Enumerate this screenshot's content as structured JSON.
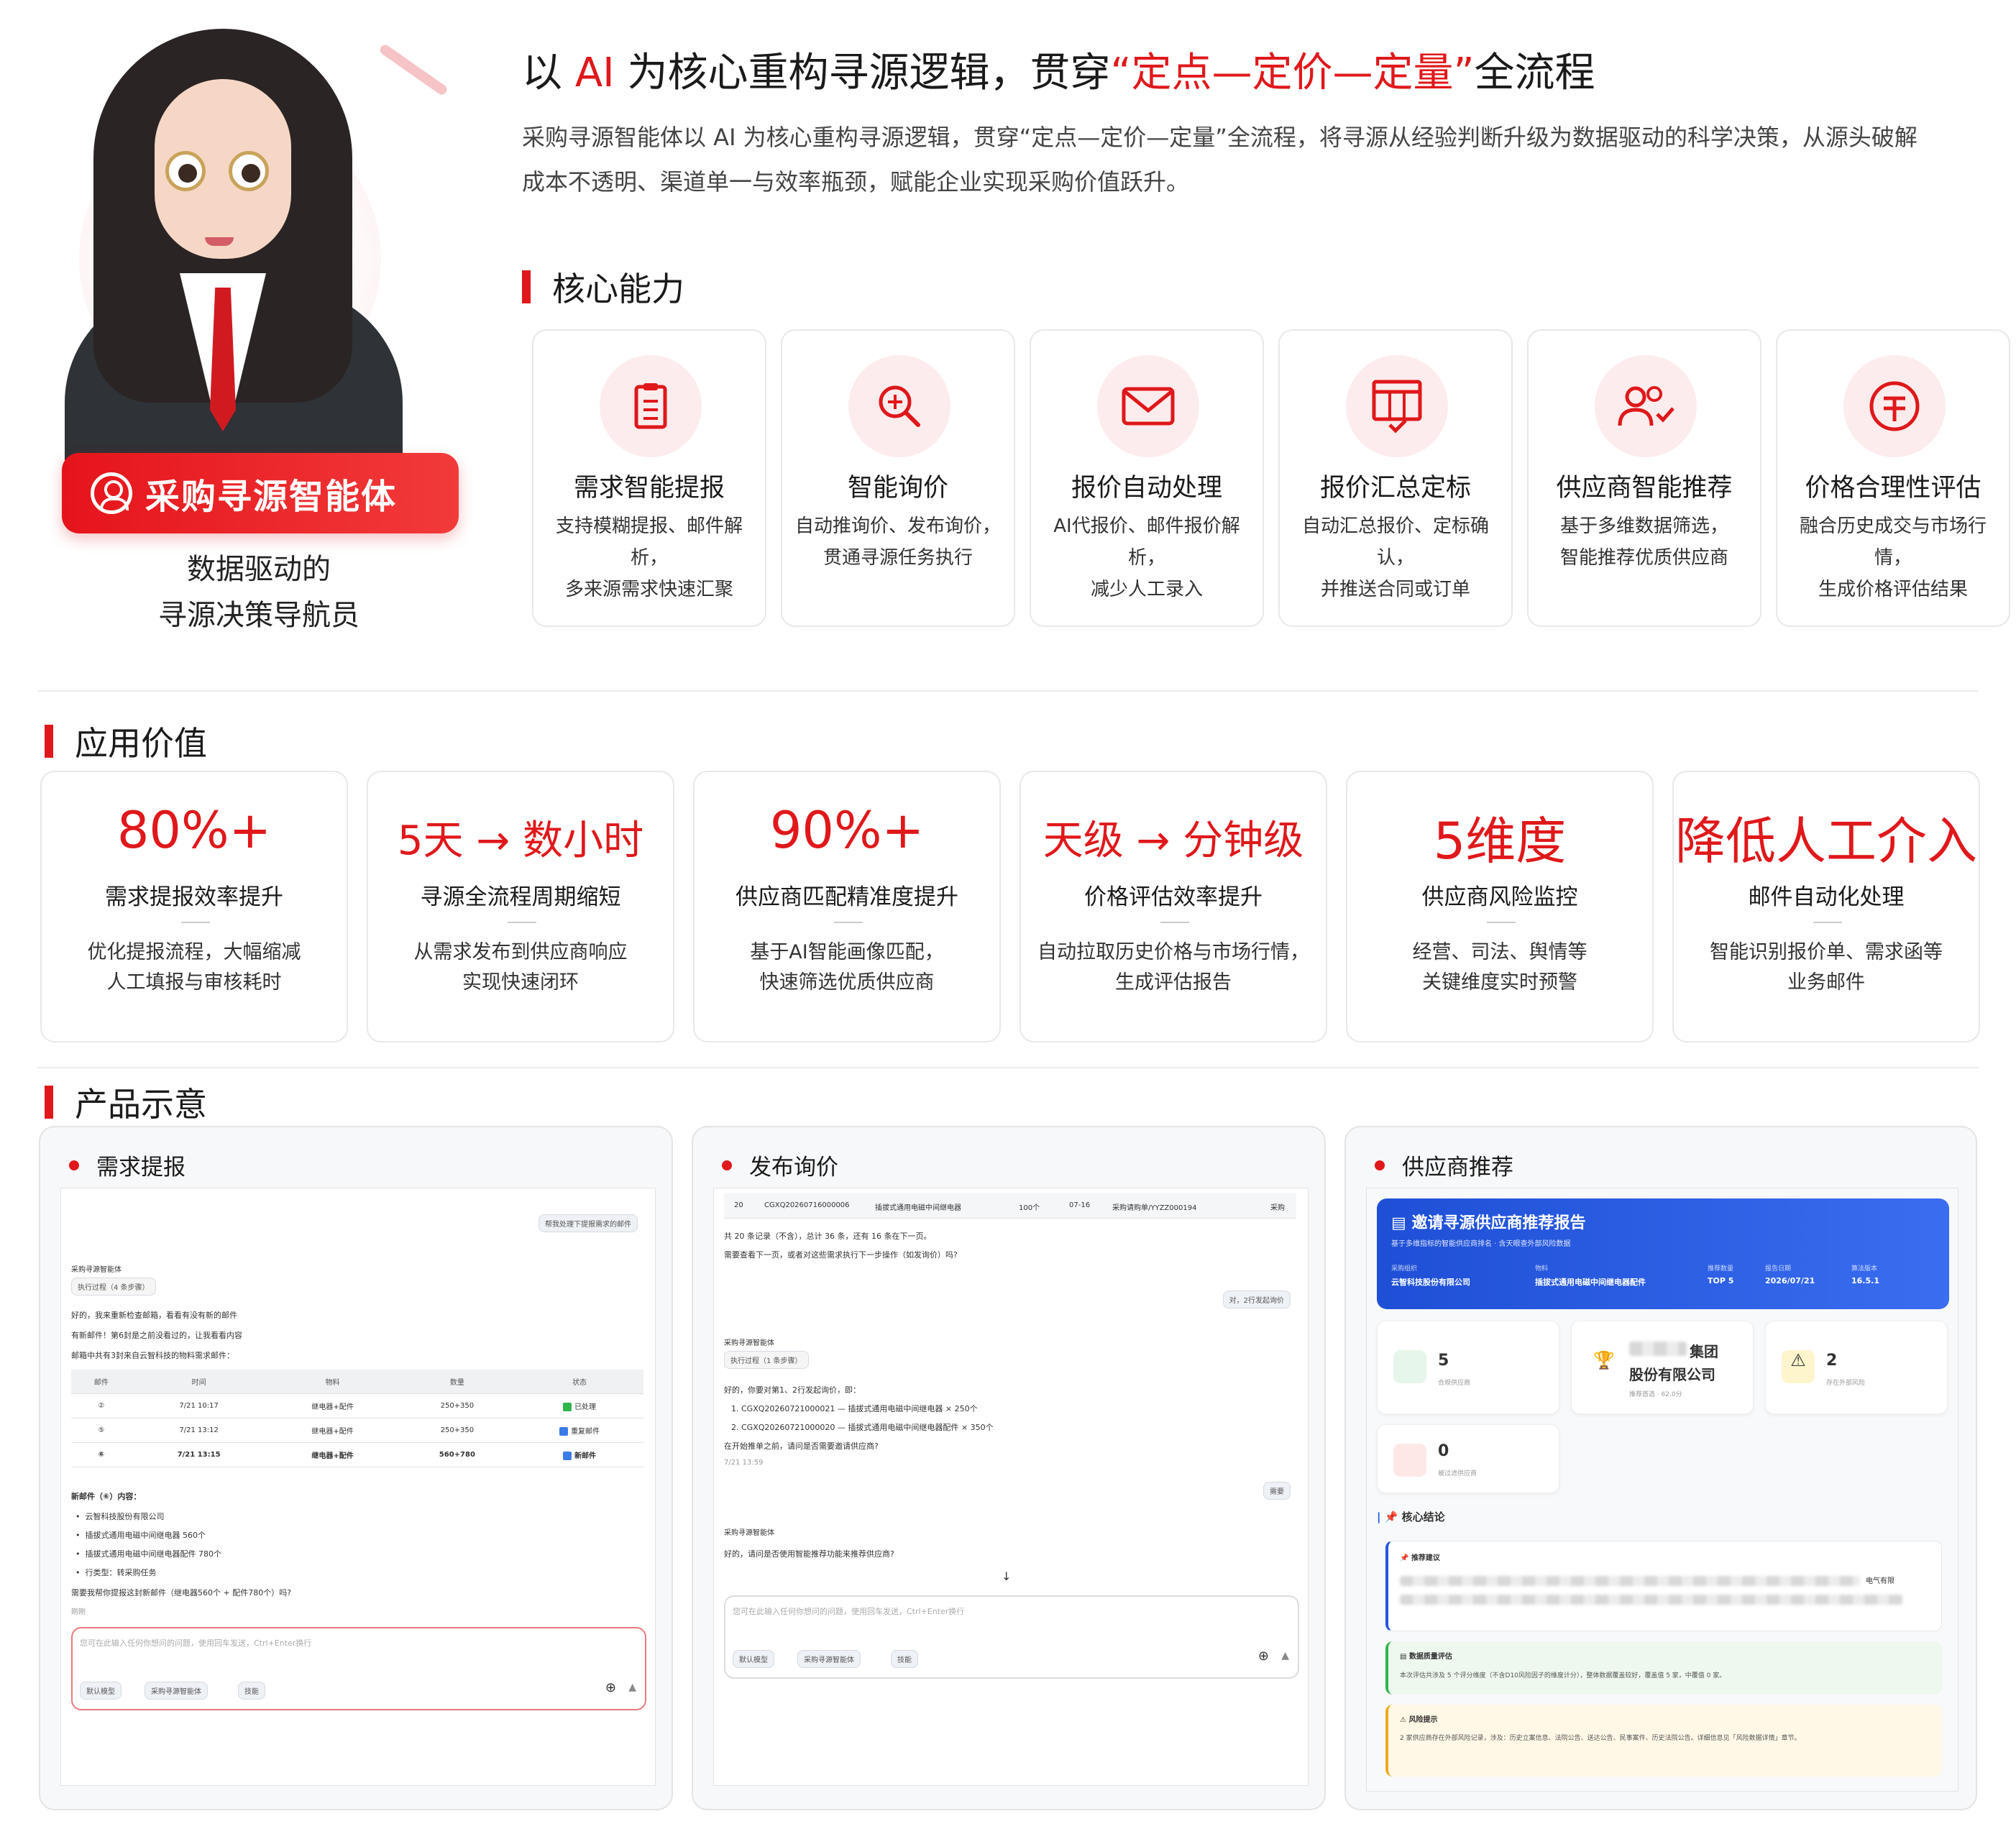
{
  "hero": {
    "badge_label": "采购寻源智能体",
    "subtitle_line1": "数据驱动的",
    "subtitle_line2": "寻源决策导航员",
    "title_prefix": "以 ",
    "title_ai": "AI",
    "title_mid": " 为核心重构寻源逻辑，贯穿",
    "title_highlight": "“定点—定价—定量”",
    "title_suffix": "全流程",
    "intro": "采购寻源智能体以 AI 为核心重构寻源逻辑，贯穿“定点—定价—定量”全流程，将寻源从经验判断升级为数据驱动的科学决策，从源头破解成本不透明、渠道单一与效率瓶颈，赋能企业实现采购价值跃升。"
  },
  "capabilities": {
    "section_title": "核心能力",
    "items": [
      {
        "icon": "clipboard-icon",
        "title": "需求智能提报",
        "desc1": "支持模糊提报、邮件解析，",
        "desc2": "多来源需求快速汇聚"
      },
      {
        "icon": "search-plus-icon",
        "title": "智能询价",
        "desc1": "自动推询价、发布询价，",
        "desc2": "贯通寻源任务执行"
      },
      {
        "icon": "mail-icon",
        "title": "报价自动处理",
        "desc1": "AI代报价、邮件报价解析，",
        "desc2": "减少人工录入"
      },
      {
        "icon": "table-check-icon",
        "title": "报价汇总定标",
        "desc1": "自动汇总报价、定标确认，",
        "desc2": "并推送合同或订单"
      },
      {
        "icon": "users-check-icon",
        "title": "供应商智能推荐",
        "desc1": "基于多维数据筛选，",
        "desc2": "智能推荐优质供应商"
      },
      {
        "icon": "yuan-icon",
        "title": "价格合理性评估",
        "desc1": "融合历史成交与市场行情，",
        "desc2": "生成价格评估结果"
      }
    ]
  },
  "values": {
    "section_title": "应用价值",
    "items": [
      {
        "num": "80%+",
        "title": "需求提报效率提升",
        "desc1": "优化提报流程，大幅缩减",
        "desc2": "人工填报与审核耗时"
      },
      {
        "num": "5天 → 数小时",
        "title": "寻源全流程周期缩短",
        "desc1": "从需求发布到供应商响应",
        "desc2": "实现快速闭环"
      },
      {
        "num": "90%+",
        "title": "供应商匹配精准度提升",
        "desc1": "基于AI智能画像匹配，",
        "desc2": "快速筛选优质供应商"
      },
      {
        "num": "天级 → 分钟级",
        "title": "价格评估效率提升",
        "desc1": "自动拉取历史价格与市场行情，",
        "desc2": "生成评估报告"
      },
      {
        "num": "5维度",
        "title": "供应商风险监控",
        "desc1": "经营、司法、舆情等",
        "desc2": "关键维度实时预警"
      },
      {
        "num": "降低人工介入",
        "title": "邮件自动化处理",
        "desc1": "智能识别报价单、需求函等",
        "desc2": "业务邮件"
      }
    ]
  },
  "products": {
    "section_title": "产品示意",
    "demo1": {
      "title": "需求提报",
      "user_msg": "帮我处理下提报需求的邮件",
      "agent_name": "采购寻源智能体",
      "exec": "执行过程（4 条步骤）",
      "line1": "好的，我来重新检查邮箱，看看有没有新的邮件",
      "line2": "有新邮件！第6封是之前没看过的，让我看看内容",
      "line3": "邮箱中共有3封来自云智科技的物料需求邮件：",
      "headers": [
        "邮件",
        "时间",
        "物料",
        "数量",
        "状态"
      ],
      "rows": [
        {
          "id": "②",
          "time": "7/21 10:17",
          "mat": "继电器+配件",
          "qty": "250+350",
          "status": "已处理"
        },
        {
          "id": "⑤",
          "time": "7/21 13:12",
          "mat": "继电器+配件",
          "qty": "250+350",
          "status": "重复邮件"
        },
        {
          "id": "⑥",
          "time": "7/21 13:15",
          "mat": "继电器+配件",
          "qty": "560+780",
          "status": "新邮件"
        }
      ],
      "new_title": "新邮件（⑥）内容：",
      "b1": "云智科技股份有限公司",
      "b2": "插拔式通用电磁中间继电器 560个",
      "b3": "插拔式通用电磁中间继电器配件 780个",
      "b4": "行类型：转采购任务",
      "ask": "需要我帮你提报这封新邮件（继电器560个 + 配件780个）吗?",
      "time": "刚刚",
      "placeholder": "您可在此输入任何你想问的问题，使用回车发送，Ctrl+Enter换行",
      "model": "默认模型",
      "agent_pill": "采购寻源智能体",
      "skill": "技能"
    },
    "demo2": {
      "title": "发布询价",
      "row_idx": "20",
      "row_code": "CGXQ20260716000006",
      "row_mat": "插拔式通用电磁中间继电器",
      "row_qty": "100个",
      "row_date": "07-16",
      "row_order": "采购请购单/YYZZ000194",
      "row_state": "采购",
      "summary": "共 20 条记录（不含），总计 36 条，还有 16 条在下一页。",
      "ask1": "需要查看下一页，或者对这些需求执行下一步操作（如发询价）吗?",
      "user_msg": "对，2行发起询价",
      "agent_name": "采购寻源智能体",
      "exec": "执行过程（1 条步骤）",
      "reply": "好的，你要对第1、2行发起询价，即：",
      "i1": "1. CGXQ20260721000021 — 插拔式通用电磁中间继电器 × 250个",
      "i2": "2. CGXQ20260721000020 — 插拔式通用电磁中间继电器配件 × 350个",
      "confirm": "在开始推单之前，请问是否需要邀请供应商?",
      "time": "7/21 13:59",
      "user2": "需要",
      "reply2": "好的，请问是否使用智能推荐功能来推荐供应商?",
      "placeholder": "您可在此输入任何你想问的问题，使用回车发送，Ctrl+Enter换行",
      "model": "默认模型",
      "agent_pill": "采购寻源智能体",
      "skill": "技能"
    },
    "demo3": {
      "title": "供应商推荐",
      "report_title": "邀请寻源供应商推荐报告",
      "report_sub": "基于多维指标的智能供应商排名 · 含天眼查外部风险数据",
      "m1_label": "采购组织",
      "m1_val": "云智科技股份有限公司",
      "m2_label": "物料",
      "m2_val": "插拔式通用电磁中间继电器配件",
      "m3_label": "推荐数量",
      "m3_val": "TOP 5",
      "m4_label": "报告日期",
      "m4_val": "2026/07/21",
      "m5_label": "算法版本",
      "m5_val": "16.5.1",
      "s1_num": "5",
      "s1_label": "合规供应商",
      "s2_name1": "集团",
      "s2_name2": "股份有限公司",
      "s2_label": "推荐首选 · 62.0分",
      "s3_num": "2",
      "s3_label": "存在外部风险",
      "s4_num": "0",
      "s4_label": "被过滤供应商",
      "conclusion": "核心结论",
      "rec_title": "推荐建议",
      "rec_tail": "电气有限",
      "quality_title": "数据质量评估",
      "quality_text": "本次评估共涉及 5 个评分维度（不含D10风险因子的维度计分），整体数据覆盖较好，覆盖值 5 家，中覆值 0 家。",
      "risk_title": "风险提示",
      "risk_text": "2 家供应商存在外部风险记录，涉及：历史立案信息、法院公告、送达公告、民事案件、历史法院公告。详细信息见「风险数据详情」章节。"
    }
  },
  "colors": {
    "accent": "#e0181b",
    "blue": "#2456e0"
  }
}
